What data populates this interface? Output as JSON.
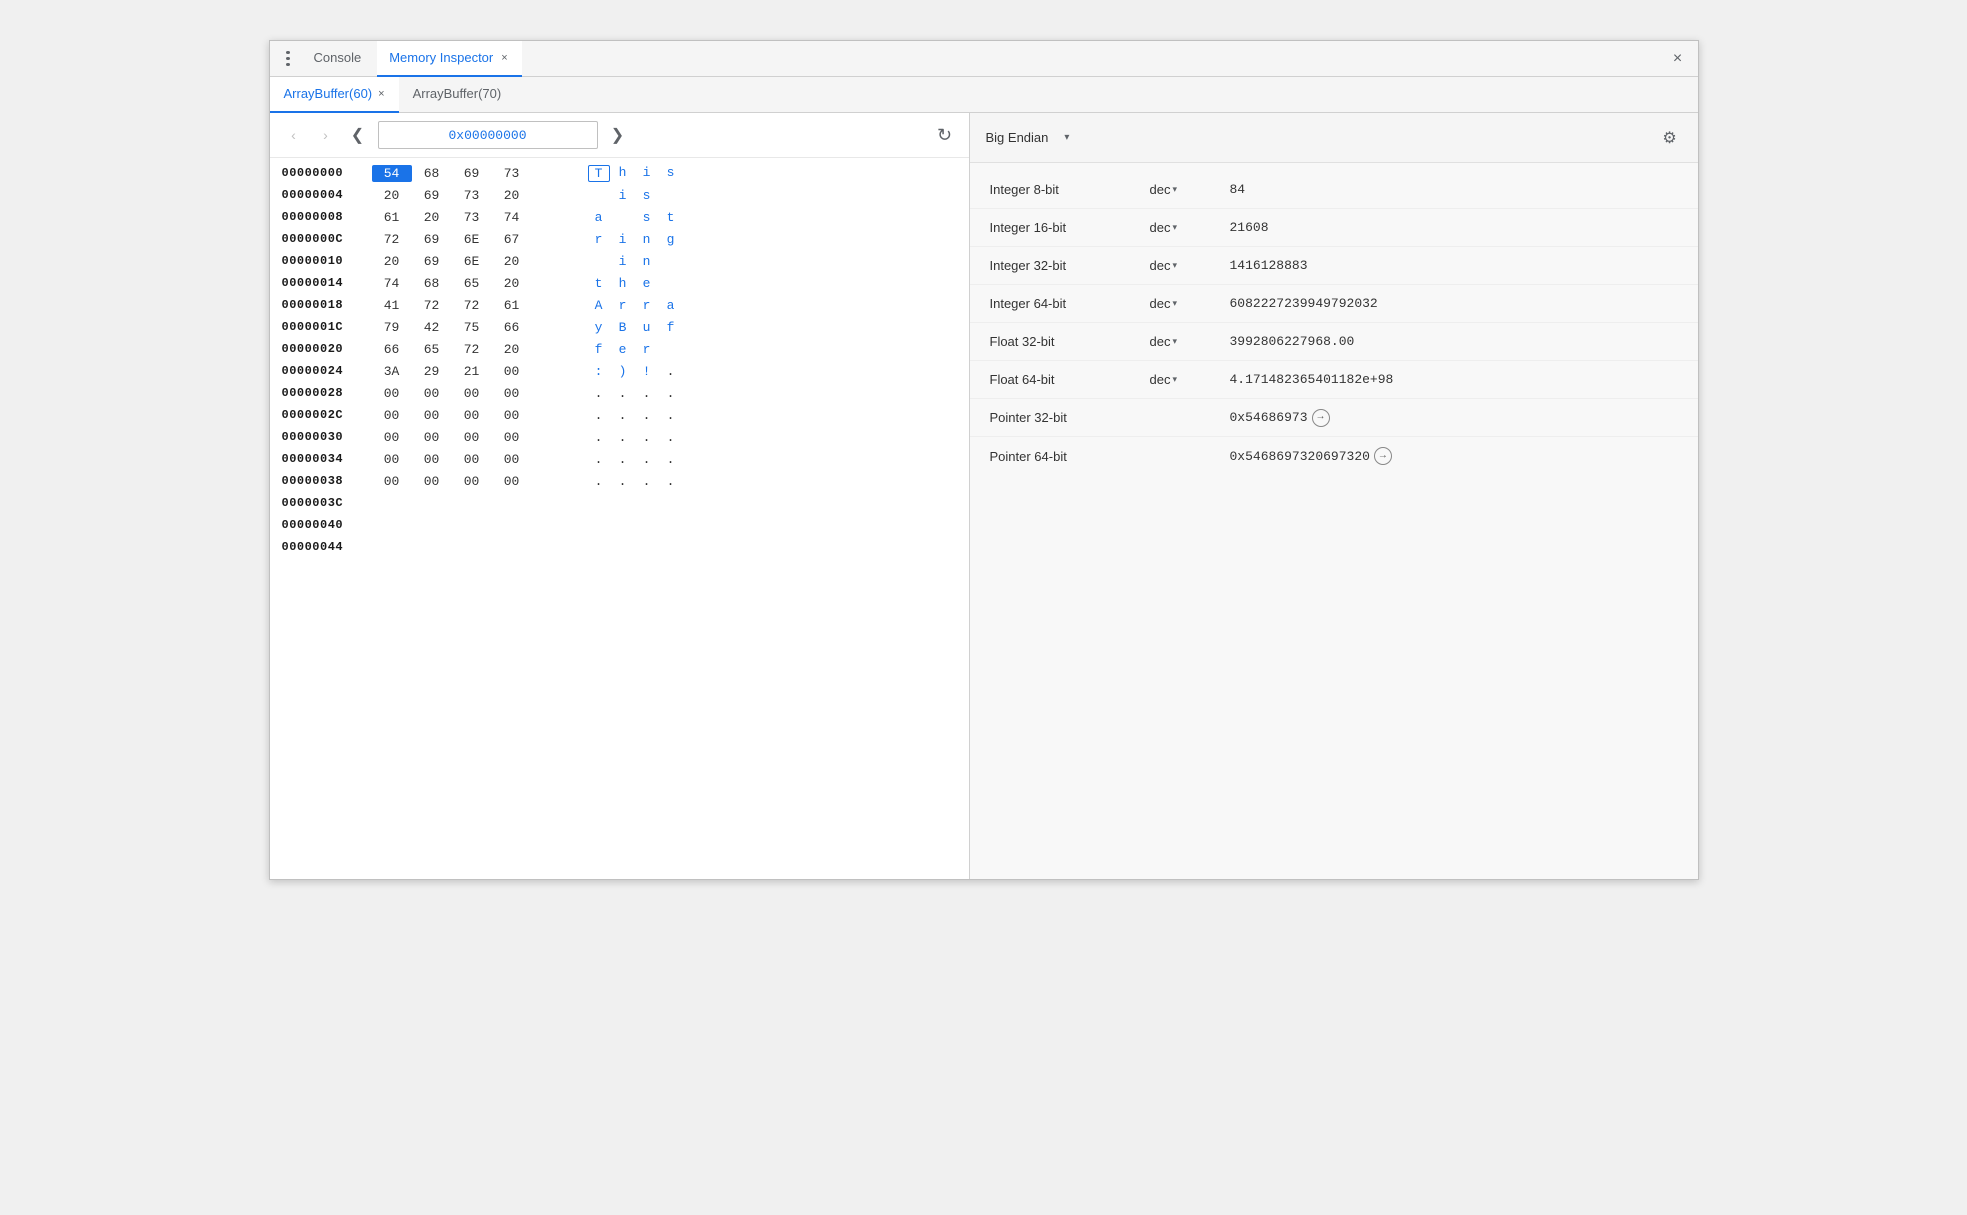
{
  "window": {
    "title": "Memory Inspector",
    "close_label": "×"
  },
  "top_toolbar": {
    "dots_label": "⋮",
    "tabs": [
      {
        "id": "console",
        "label": "Console",
        "active": false,
        "closable": false
      },
      {
        "id": "memory-inspector",
        "label": "Memory Inspector",
        "active": true,
        "closable": true
      }
    ]
  },
  "buffer_tabs": [
    {
      "id": "arraybuffer-60",
      "label": "ArrayBuffer(60)",
      "active": true,
      "closable": true
    },
    {
      "id": "arraybuffer-70",
      "label": "ArrayBuffer(70)",
      "active": false,
      "closable": false
    }
  ],
  "memory_panel": {
    "nav": {
      "back_label": "‹",
      "forward_label": "›",
      "address": "0x00000000",
      "refresh_label": "↺",
      "left_arrow": "❮",
      "right_arrow": "❯"
    },
    "rows": [
      {
        "address": "00000000",
        "hex": [
          "54",
          "68",
          "69",
          "73"
        ],
        "ascii": [
          "T",
          "h",
          "i",
          "s"
        ],
        "selected_hex": 0,
        "selected_ascii": 0
      },
      {
        "address": "00000004",
        "hex": [
          "20",
          "69",
          "73",
          "20"
        ],
        "ascii": [
          " ",
          "i",
          "s",
          " "
        ],
        "selected_hex": -1,
        "selected_ascii": -1
      },
      {
        "address": "00000008",
        "hex": [
          "61",
          "20",
          "73",
          "74"
        ],
        "ascii": [
          "a",
          " ",
          "s",
          "t"
        ],
        "selected_hex": -1,
        "selected_ascii": -1
      },
      {
        "address": "0000000C",
        "hex": [
          "72",
          "69",
          "6E",
          "67"
        ],
        "ascii": [
          "r",
          "i",
          "n",
          "g"
        ],
        "selected_hex": -1,
        "selected_ascii": -1
      },
      {
        "address": "00000010",
        "hex": [
          "20",
          "69",
          "6E",
          "20"
        ],
        "ascii": [
          " ",
          "i",
          "n",
          " "
        ],
        "selected_hex": -1,
        "selected_ascii": -1
      },
      {
        "address": "00000014",
        "hex": [
          "74",
          "68",
          "65",
          "20"
        ],
        "ascii": [
          "t",
          "h",
          "e",
          " "
        ],
        "selected_hex": -1,
        "selected_ascii": -1
      },
      {
        "address": "00000018",
        "hex": [
          "41",
          "72",
          "72",
          "61"
        ],
        "ascii": [
          "A",
          "r",
          "r",
          "a"
        ],
        "selected_hex": -1,
        "selected_ascii": -1
      },
      {
        "address": "0000001C",
        "hex": [
          "79",
          "42",
          "75",
          "66"
        ],
        "ascii": [
          "y",
          "B",
          "u",
          "f"
        ],
        "selected_hex": -1,
        "selected_ascii": -1
      },
      {
        "address": "00000020",
        "hex": [
          "66",
          "65",
          "72",
          "20"
        ],
        "ascii": [
          "f",
          "e",
          "r",
          " "
        ],
        "selected_hex": -1,
        "selected_ascii": -1
      },
      {
        "address": "00000024",
        "hex": [
          "3A",
          "29",
          "21",
          "00"
        ],
        "ascii": [
          ":",
          ")",
          "!",
          "."
        ],
        "selected_hex": -1,
        "selected_ascii": -1
      },
      {
        "address": "00000028",
        "hex": [
          "00",
          "00",
          "00",
          "00"
        ],
        "ascii": [
          ".",
          ".",
          ".",
          "."
        ],
        "selected_hex": -1,
        "selected_ascii": -1
      },
      {
        "address": "0000002C",
        "hex": [
          "00",
          "00",
          "00",
          "00"
        ],
        "ascii": [
          ".",
          ".",
          ".",
          "."
        ],
        "selected_hex": -1,
        "selected_ascii": -1
      },
      {
        "address": "00000030",
        "hex": [
          "00",
          "00",
          "00",
          "00"
        ],
        "ascii": [
          ".",
          ".",
          ".",
          "."
        ],
        "selected_hex": -1,
        "selected_ascii": -1
      },
      {
        "address": "00000034",
        "hex": [
          "00",
          "00",
          "00",
          "00"
        ],
        "ascii": [
          ".",
          ".",
          ".",
          "."
        ],
        "selected_hex": -1,
        "selected_ascii": -1
      },
      {
        "address": "00000038",
        "hex": [
          "00",
          "00",
          "00",
          "00"
        ],
        "ascii": [
          ".",
          ".",
          ".",
          "."
        ],
        "selected_hex": -1,
        "selected_ascii": -1
      },
      {
        "address": "0000003C",
        "hex": [],
        "ascii": [],
        "empty": true
      },
      {
        "address": "00000040",
        "hex": [],
        "ascii": [],
        "empty": true
      },
      {
        "address": "00000044",
        "hex": [],
        "ascii": [],
        "empty": true
      }
    ]
  },
  "inspector_panel": {
    "endian": {
      "label": "Big Endian",
      "arrow": "▾"
    },
    "gear_label": "⚙",
    "rows": [
      {
        "type": "Integer 8-bit",
        "format": "dec",
        "has_dropdown": true,
        "value": "84",
        "is_pointer": false
      },
      {
        "type": "Integer 16-bit",
        "format": "dec",
        "has_dropdown": true,
        "value": "21608",
        "is_pointer": false
      },
      {
        "type": "Integer 32-bit",
        "format": "dec",
        "has_dropdown": true,
        "value": "1416128883",
        "is_pointer": false
      },
      {
        "type": "Integer 64-bit",
        "format": "dec",
        "has_dropdown": true,
        "value": "6082227239949792032",
        "is_pointer": false
      },
      {
        "type": "Float 32-bit",
        "format": "dec",
        "has_dropdown": true,
        "value": "3992806227968.00",
        "is_pointer": false
      },
      {
        "type": "Float 64-bit",
        "format": "dec",
        "has_dropdown": true,
        "value": "4.171482365401182e+98",
        "is_pointer": false
      },
      {
        "type": "Pointer 32-bit",
        "format": "",
        "has_dropdown": false,
        "value": "0x54686973",
        "is_pointer": true,
        "arrow": "→"
      },
      {
        "type": "Pointer 64-bit",
        "format": "",
        "has_dropdown": false,
        "value": "0x5468697320697320",
        "is_pointer": true,
        "arrow": "→"
      }
    ]
  }
}
